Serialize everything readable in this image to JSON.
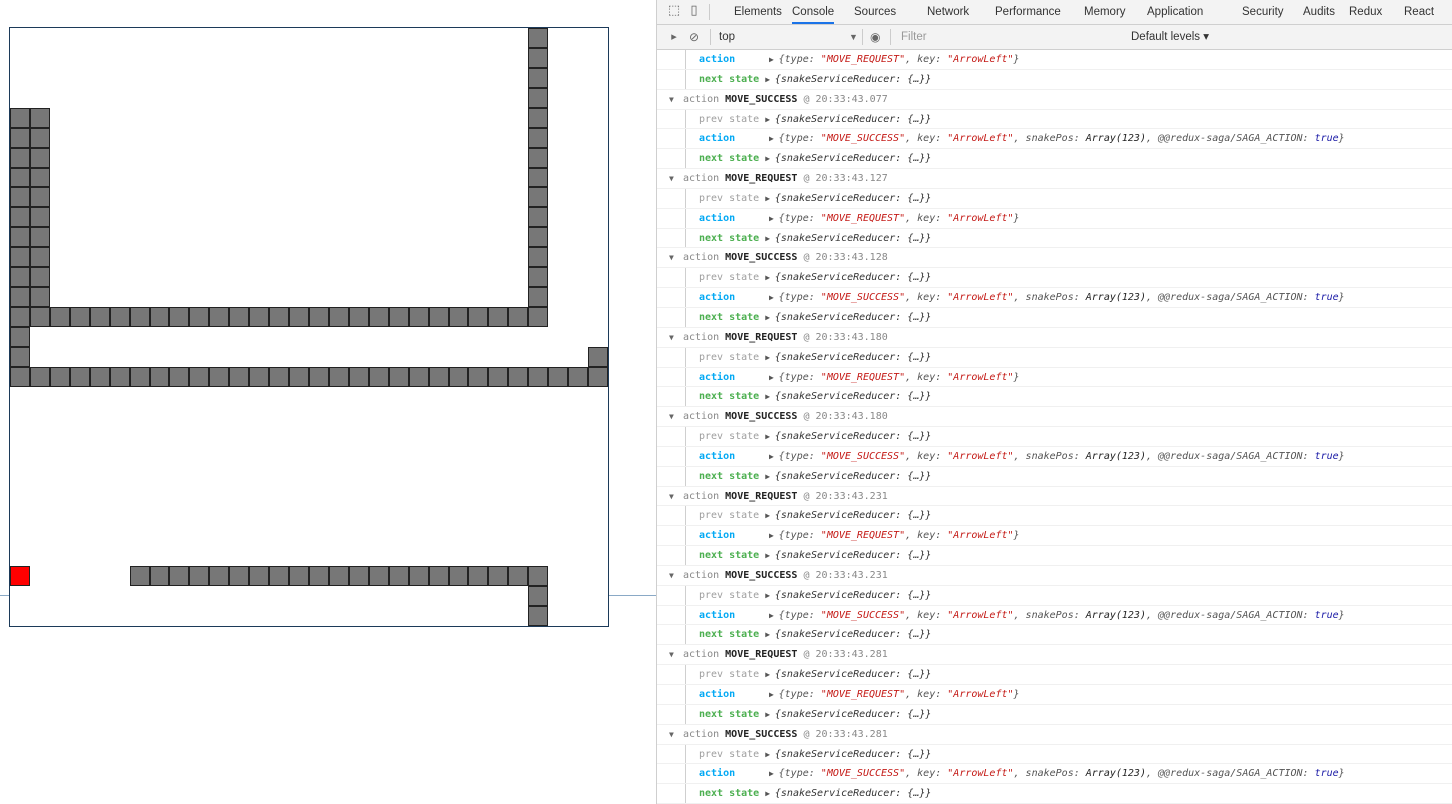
{
  "devtools": {
    "tabs": [
      "Elements",
      "Console",
      "Sources",
      "Network",
      "Performance",
      "Memory",
      "Application",
      "Security",
      "Audits",
      "Redux",
      "React"
    ],
    "active_tab": "Console",
    "toolbar": {
      "context": "top",
      "filter_placeholder": "Filter",
      "levels": "Default levels ▾"
    }
  },
  "console_rows": [
    {
      "kind": "action",
      "key": "ArrowLeft",
      "type": "MOVE_REQUEST"
    },
    {
      "kind": "next"
    },
    {
      "kind": "group",
      "name": "MOVE_SUCCESS",
      "time": "20:33:43.077"
    },
    {
      "kind": "prev"
    },
    {
      "kind": "action",
      "key": "ArrowLeft",
      "type": "MOVE_SUCCESS"
    },
    {
      "kind": "next"
    },
    {
      "kind": "group",
      "name": "MOVE_REQUEST",
      "time": "20:33:43.127"
    },
    {
      "kind": "prev"
    },
    {
      "kind": "action",
      "key": "ArrowLeft",
      "type": "MOVE_REQUEST"
    },
    {
      "kind": "next"
    },
    {
      "kind": "group",
      "name": "MOVE_SUCCESS",
      "time": "20:33:43.128"
    },
    {
      "kind": "prev"
    },
    {
      "kind": "action",
      "key": "ArrowLeft",
      "type": "MOVE_SUCCESS"
    },
    {
      "kind": "next"
    },
    {
      "kind": "group",
      "name": "MOVE_REQUEST",
      "time": "20:33:43.180"
    },
    {
      "kind": "prev"
    },
    {
      "kind": "action",
      "key": "ArrowLeft",
      "type": "MOVE_REQUEST"
    },
    {
      "kind": "next"
    },
    {
      "kind": "group",
      "name": "MOVE_SUCCESS",
      "time": "20:33:43.180"
    },
    {
      "kind": "prev"
    },
    {
      "kind": "action",
      "key": "ArrowLeft",
      "type": "MOVE_SUCCESS"
    },
    {
      "kind": "next"
    },
    {
      "kind": "group",
      "name": "MOVE_REQUEST",
      "time": "20:33:43.231"
    },
    {
      "kind": "prev"
    },
    {
      "kind": "action",
      "key": "ArrowLeft",
      "type": "MOVE_REQUEST"
    },
    {
      "kind": "next"
    },
    {
      "kind": "group",
      "name": "MOVE_SUCCESS",
      "time": "20:33:43.231"
    },
    {
      "kind": "prev"
    },
    {
      "kind": "action",
      "key": "ArrowLeft",
      "type": "MOVE_SUCCESS"
    },
    {
      "kind": "next"
    },
    {
      "kind": "group",
      "name": "MOVE_REQUEST",
      "time": "20:33:43.281"
    },
    {
      "kind": "prev"
    },
    {
      "kind": "action",
      "key": "ArrowLeft",
      "type": "MOVE_REQUEST"
    },
    {
      "kind": "next"
    },
    {
      "kind": "group",
      "name": "MOVE_SUCCESS",
      "time": "20:33:43.281"
    },
    {
      "kind": "prev"
    },
    {
      "kind": "action",
      "key": "ArrowLeft",
      "type": "MOVE_SUCCESS"
    },
    {
      "kind": "next"
    }
  ],
  "strings": {
    "action_word": "action",
    "prev_state": "prev state",
    "next_state": "next state",
    "reducer_obj": "{snakeServiceReducer: {…}}",
    "snake_pos": "Array(123)",
    "saga_flag": "@@redux-saga/SAGA_ACTION",
    "true_word": "true"
  },
  "game": {
    "grid_size": 30,
    "food_color": "#ff0000",
    "snake_color": "#777777",
    "food": [
      0,
      27
    ],
    "snake_runs": [
      {
        "dir": "v",
        "x": 26,
        "from": 0,
        "to": 14
      },
      {
        "dir": "h",
        "y": 14,
        "from": 1,
        "to": 26
      },
      {
        "dir": "v",
        "x": 1,
        "from": 4,
        "to": 14
      },
      {
        "dir": "v",
        "x": 0,
        "from": 4,
        "to": 17
      },
      {
        "dir": "h",
        "y": 17,
        "from": 0,
        "to": 29
      },
      {
        "dir": "v",
        "x": 29,
        "from": 16,
        "to": 17
      },
      {
        "dir": "h",
        "y": 27,
        "from": 6,
        "to": 26
      },
      {
        "dir": "v",
        "x": 26,
        "from": 28,
        "to": 29
      }
    ]
  }
}
